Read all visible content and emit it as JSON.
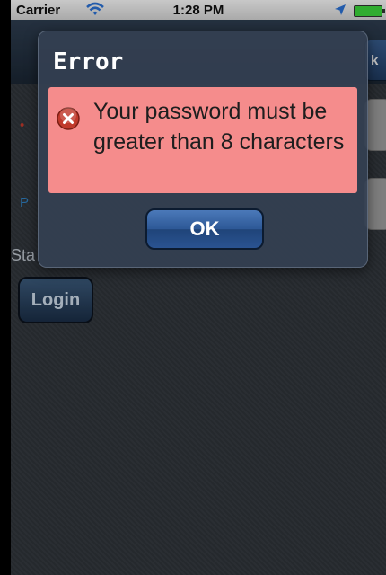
{
  "status_bar": {
    "carrier": "Carrier",
    "time": "1:28 PM"
  },
  "navbar": {
    "back_label": "k"
  },
  "login_form": {
    "stay_label": "Sta",
    "login_label": "Login"
  },
  "alert": {
    "title": "Error",
    "message": "Your password must be greater than 8 characters",
    "ok_label": "OK"
  },
  "icons": {
    "wifi": "wifi-icon",
    "location": "location-arrow-icon",
    "battery": "battery-icon",
    "error": "error-x-icon"
  },
  "colors": {
    "error_bg": "#f58c8c",
    "error_icon": "#c0392b",
    "alert_bg": "#344052",
    "button_blue": "#2d5896",
    "battery": "#3bd23b"
  }
}
